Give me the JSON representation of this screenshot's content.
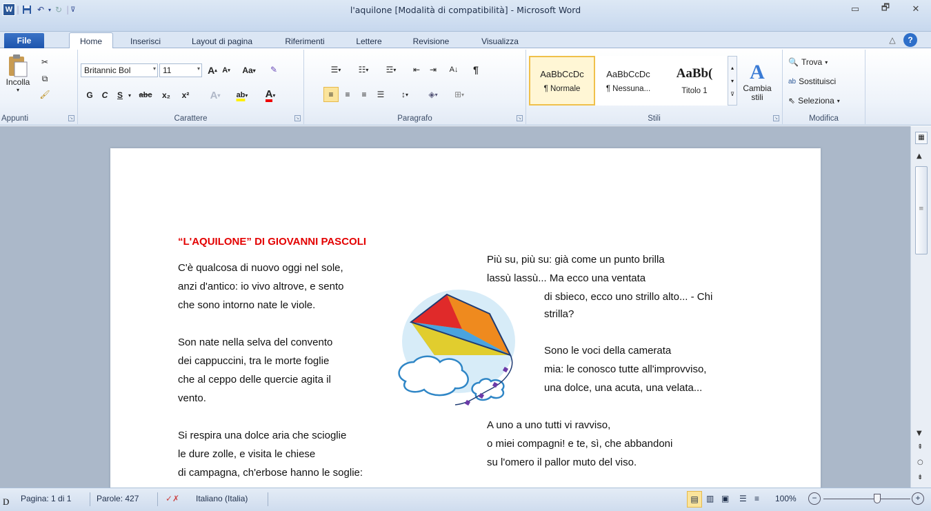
{
  "window": {
    "title": "l'aquilone [Modalità di compatibilità] - Microsoft Word",
    "app_icon_letter": "W",
    "minimize": "▭",
    "restore": "🗗",
    "close": "✕"
  },
  "tabs": {
    "file": "File",
    "items": [
      "Home",
      "Inserisci",
      "Layout di pagina",
      "Riferimenti",
      "Lettere",
      "Revisione",
      "Visualizza"
    ]
  },
  "ribbon": {
    "clipboard": {
      "paste": "Incolla",
      "label": "Appunti"
    },
    "font": {
      "font_name": "Britannic Bol",
      "font_size": "11",
      "grow": "A",
      "shrink": "A",
      "case": "Aa",
      "bold": "G",
      "italic": "C",
      "underline": "S",
      "strike": "abc",
      "subscript": "x₂",
      "superscript": "x²",
      "highlight": "ab",
      "color": "A",
      "label": "Carattere"
    },
    "paragraph": {
      "label": "Paragrafo",
      "pilcrow": "¶"
    },
    "styles": {
      "items": [
        {
          "preview": "AaBbCcDc",
          "name": "¶ Normale"
        },
        {
          "preview": "AaBbCcDc",
          "name": "¶ Nessuna..."
        },
        {
          "preview": "AaBb(",
          "name": "Titolo 1"
        }
      ],
      "change": "Cambia stili",
      "label": "Stili"
    },
    "editing": {
      "find": "Trova",
      "replace": "Sostituisci",
      "select": "Seleziona",
      "label": "Modifica"
    }
  },
  "document": {
    "heading": "“L'AQUILONE” DI GIOVANNI PASCOLI",
    "left_lines": [
      "C'è qualcosa di nuovo oggi nel sole,",
      "anzi d'antico: io vivo altrove, e sento",
      "che sono intorno nate le viole.",
      "",
      "Son nate nella selva del convento",
      "dei cappuccini, tra le morte foglie",
      "che al ceppo delle quercie agita il",
      "vento.",
      "",
      "Si respira una dolce aria che scioglie",
      "le dure zolle, e visita le chiese",
      "di campagna, ch'erbose hanno le soglie:"
    ],
    "right_lines": [
      "Più su, più su: già come un punto brilla",
      "lassù lassù... Ma ecco una ventata",
      "di sbieco, ecco uno strillo alto... - Chi",
      "strilla?",
      "",
      "Sono le voci della camerata",
      "mia: le conosco tutte all'improvviso,",
      "una dolce, una acuta, una velata...",
      "",
      "A uno a uno tutti vi ravviso,",
      "o miei compagni! e te, sì, che abbandoni",
      "su l'omero il pallor muto del viso."
    ]
  },
  "status": {
    "page": "Pagina: 1 di 1",
    "words": "Parole: 427",
    "language": "Italiano (Italia)",
    "zoom": "100%",
    "zoom_level": 1.0
  },
  "colors": {
    "heading": "#e30000",
    "accent": "#2b5797"
  },
  "outside_char": "D"
}
